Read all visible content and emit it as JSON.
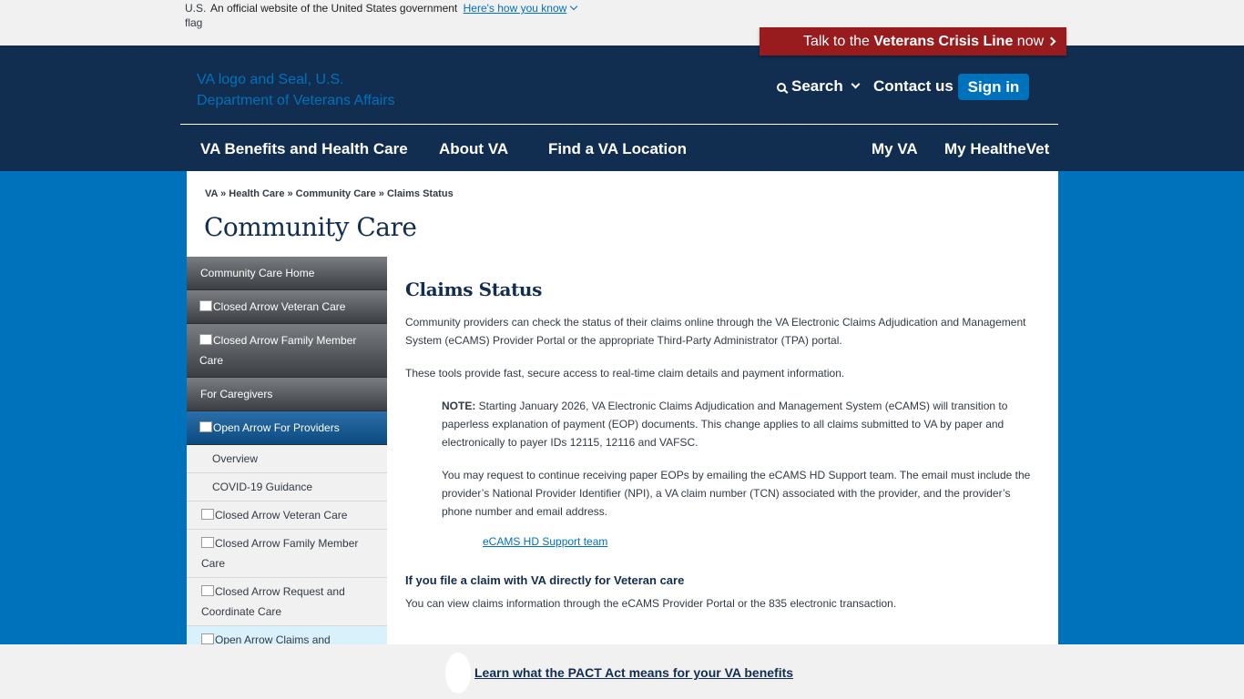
{
  "banner": {
    "flag_alt": "U.S. flag",
    "official_text": "An official website of the United States government",
    "how_link": "Here's how you know"
  },
  "crisis": {
    "prefix": "Talk to the ",
    "bold": "Veterans Crisis Line",
    "suffix": " now"
  },
  "header": {
    "logo_alt": "VA logo and Seal, U.S. Department of Veterans Affairs",
    "search": "Search",
    "contact": "Contact us",
    "signin": "Sign in"
  },
  "nav": {
    "benefits": "VA Benefits and Health Care",
    "about": "About VA",
    "find": "Find a VA Location",
    "myva": "My VA",
    "healthevet": "My HealtheVet"
  },
  "breadcrumb": {
    "items": [
      "VA",
      "Health Care",
      "Community Care",
      "Claims Status"
    ],
    "sep": " » "
  },
  "page_title": "Community Care",
  "sidebar": {
    "home": "Community Care Home",
    "veteran_care": "Closed Arrow Veteran Care",
    "family_care": "Closed Arrow Family Member Care",
    "caregivers": "For Caregivers",
    "providers": "Open Arrow For Providers",
    "sub": {
      "overview": "Overview",
      "covid": "COVID-19 Guidance",
      "veteran_care": "Closed Arrow Veteran Care",
      "family_care": "Closed Arrow Family Member Care",
      "request": "Closed Arrow Request and Coordinate Care",
      "claims": "Open Arrow Claims and Payments"
    }
  },
  "content": {
    "heading": "Claims Status",
    "p1": "Community providers can check the status of their claims online through the VA Electronic Claims Adjudication and Management System (eCAMS) Provider Portal or the appropriate Third-Party Administrator (TPA) portal.",
    "p2": "These tools provide fast, secure access to real-time claim details and payment information.",
    "note_label": "NOTE:",
    "note_text": " Starting January 2026, VA Electronic Claims Adjudication and Management System (eCAMS) will transition to paperless explanation of payment (EOP) documents. This change applies to all claims submitted to VA by paper and electronically to payer IDs 12115, 12116 and VAFSC.",
    "note_p2": "You may request to continue receiving paper EOPs by emailing the eCAMS HD Support team. The email must include the provider’s National Provider Identifier (NPI), a VA claim number (TCN) associated with the provider, and the provider’s phone number and email address.",
    "support_link": "eCAMS HD Support team",
    "subheading": "If you file a claim with VA directly for Veteran care",
    "p3": "You can view claims information through the eCAMS Provider Portal or the 835 electronic transaction."
  },
  "bottom": {
    "pact_link": "Learn what the PACT Act means for your VA benefits"
  }
}
